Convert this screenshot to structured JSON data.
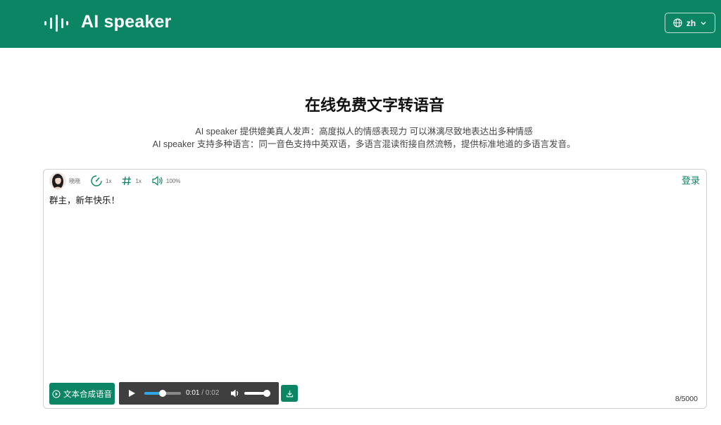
{
  "header": {
    "logo_icon": "sound-bars-icon",
    "title": "AI speaker",
    "lang_icon": "globe-icon",
    "lang_label": "zh",
    "lang_chevron": "chevron-down-icon",
    "bg_color": "#0b8563"
  },
  "hero": {
    "title": "在线免费文字转语音",
    "desc_line1": "AI speaker 提供媲美真人发声：高度拟人的情感表现力 可以淋漓尽致地表达出多种情感",
    "desc_line2": "AI speaker 支持多种语言：同一音色支持中英双语，多语言混读衔接自然流畅，提供标准地道的多语言发音。"
  },
  "editor": {
    "voice_name": "晓晓",
    "speed_icon": "speedometer-icon",
    "speed": "1x",
    "pitch_icon": "hash-icon",
    "pitch": "1x",
    "volume_icon": "speaker-icon",
    "volume": "100%",
    "login": "登录",
    "text": "群主，新年快乐！",
    "char_count": "8/5000"
  },
  "actions": {
    "generate_icon": "play-circle-icon",
    "generate_label": "文本合成语音",
    "download_icon": "download-icon"
  },
  "player": {
    "current_time": "0:01",
    "separator": " / ",
    "duration": "0:02",
    "progress_fraction": 0.5,
    "volume_fraction": 1.0
  }
}
